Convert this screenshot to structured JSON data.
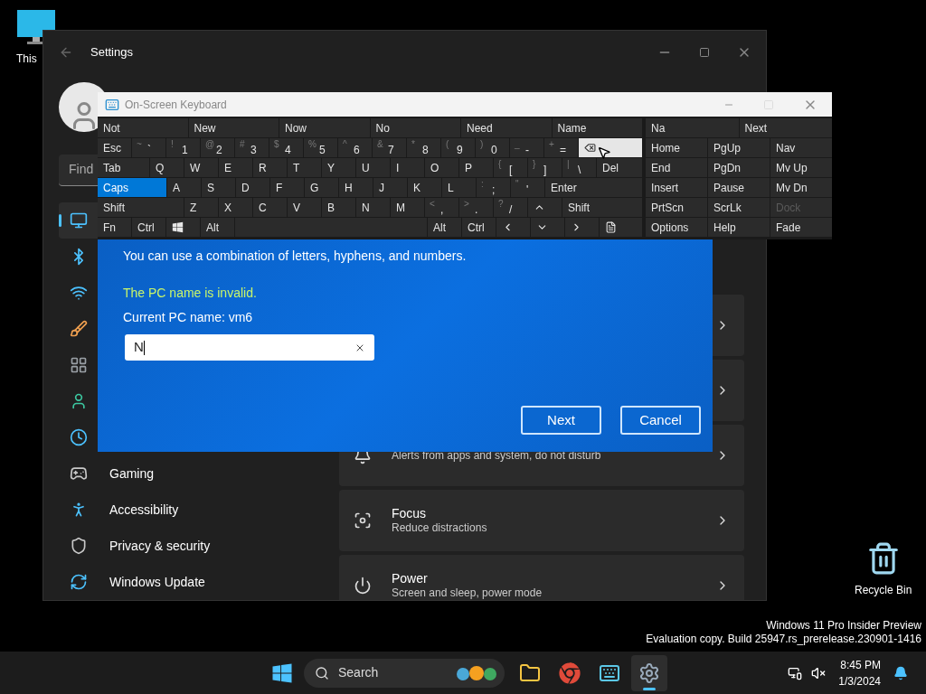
{
  "desktop_icons": [
    {
      "kind": "pc",
      "label": "This"
    },
    {
      "kind": "bin",
      "label": "Recycle Bin"
    }
  ],
  "settings": {
    "title": "Settings",
    "search_placeholder": "Find",
    "sidebar": [
      {
        "selected": true
      },
      {
        "selected": false
      },
      {
        "selected": false
      },
      {
        "selected": false
      },
      {
        "selected": false
      },
      {
        "selected": false
      },
      {
        "selected": false
      },
      {
        "label": "Gaming",
        "selected": false
      },
      {
        "label": "Accessibility",
        "selected": false
      },
      {
        "label": "Privacy & security",
        "selected": false
      },
      {
        "label": "Windows Update",
        "selected": false
      }
    ],
    "cards": [
      {
        "kind": "covered"
      },
      {
        "kind": "covered"
      },
      {
        "kind": "item",
        "subtitle": "Alerts from apps and system, do not disturb"
      },
      {
        "kind": "item",
        "title": "Focus",
        "subtitle": "Reduce distractions"
      },
      {
        "kind": "item",
        "title": "Power",
        "subtitle": "Screen and sleep, power mode"
      }
    ]
  },
  "dialog": {
    "hint": "You can use a combination of letters, hyphens, and numbers.",
    "error": "The PC name is invalid.",
    "current": "Current PC name: vm6",
    "value": "N",
    "buttons": [
      "Next",
      "Cancel"
    ]
  },
  "keyboard": {
    "title": "On-Screen Keyboard",
    "predictions": [
      "Not",
      "New",
      "Now",
      "No",
      "Need",
      "Name"
    ],
    "nav_predictions": [
      "Na",
      "Next"
    ],
    "key_lines": [
      {
        "keys": [
          {
            "label": "Esc",
            "on": false,
            "hovered": false
          },
          {
            "label": "`",
            "shift": "~",
            "on": false,
            "hovered": false
          },
          {
            "label": "1",
            "shift": "!",
            "on": false,
            "hovered": false
          },
          {
            "label": "2",
            "shift": "@",
            "on": false,
            "hovered": false
          },
          {
            "label": "3",
            "shift": "#",
            "on": false,
            "hovered": false
          },
          {
            "label": "4",
            "shift": "$",
            "on": false,
            "hovered": false
          },
          {
            "label": "5",
            "shift": "%",
            "on": false,
            "hovered": false
          },
          {
            "label": "6",
            "shift": "^",
            "on": false,
            "hovered": false
          },
          {
            "label": "7",
            "shift": "&",
            "on": false,
            "hovered": false
          },
          {
            "label": "8",
            "shift": "*",
            "on": false,
            "hovered": false
          },
          {
            "label": "9",
            "shift": "(",
            "on": false,
            "hovered": false
          },
          {
            "label": "0",
            "shift": ")",
            "on": false,
            "hovered": false
          },
          {
            "label": "-",
            "shift": "_",
            "on": false,
            "hovered": false
          },
          {
            "label": "=",
            "shift": "+",
            "on": false,
            "hovered": false
          },
          {
            "kind": "backspace",
            "on": false,
            "hovered": true
          }
        ]
      },
      {
        "keys": [
          {
            "label": "Tab",
            "on": false,
            "hovered": false
          },
          {
            "label": "Q",
            "on": false,
            "hovered": false
          },
          {
            "label": "W",
            "on": false,
            "hovered": false
          },
          {
            "label": "E",
            "on": false,
            "hovered": false
          },
          {
            "label": "R",
            "on": false,
            "hovered": false
          },
          {
            "label": "T",
            "on": false,
            "hovered": false
          },
          {
            "label": "Y",
            "on": false,
            "hovered": false
          },
          {
            "label": "U",
            "on": false,
            "hovered": false
          },
          {
            "label": "I",
            "on": false,
            "hovered": false
          },
          {
            "label": "O",
            "on": false,
            "hovered": false
          },
          {
            "label": "P",
            "on": false,
            "hovered": false
          },
          {
            "label": "[",
            "shift": "{",
            "on": false,
            "hovered": false
          },
          {
            "label": "]",
            "shift": "}",
            "on": false,
            "hovered": false
          },
          {
            "label": "\\",
            "shift": "|",
            "on": false,
            "hovered": false
          },
          {
            "label": "Del",
            "on": false,
            "hovered": false
          }
        ]
      },
      {
        "keys": [
          {
            "label": "Caps",
            "on": true,
            "hovered": false
          },
          {
            "label": "A",
            "on": false,
            "hovered": false
          },
          {
            "label": "S",
            "on": false,
            "hovered": false
          },
          {
            "label": "D",
            "on": false,
            "hovered": false
          },
          {
            "label": "F",
            "on": false,
            "hovered": false
          },
          {
            "label": "G",
            "on": false,
            "hovered": false
          },
          {
            "label": "H",
            "on": false,
            "hovered": false
          },
          {
            "label": "J",
            "on": false,
            "hovered": false
          },
          {
            "label": "K",
            "on": false,
            "hovered": false
          },
          {
            "label": "L",
            "on": false,
            "hovered": false
          },
          {
            "label": ";",
            "shift": ":",
            "on": false,
            "hovered": false
          },
          {
            "label": "'",
            "shift": "\"",
            "on": false,
            "hovered": false
          },
          {
            "label": "Enter",
            "on": false,
            "hovered": false
          }
        ]
      },
      {
        "keys": [
          {
            "label": "Shift",
            "on": false,
            "hovered": false
          },
          {
            "label": "Z",
            "on": false,
            "hovered": false
          },
          {
            "label": "X",
            "on": false,
            "hovered": false
          },
          {
            "label": "C",
            "on": false,
            "hovered": false
          },
          {
            "label": "V",
            "on": false,
            "hovered": false
          },
          {
            "label": "B",
            "on": false,
            "hovered": false
          },
          {
            "label": "N",
            "on": false,
            "hovered": false
          },
          {
            "label": "M",
            "on": false,
            "hovered": false
          },
          {
            "label": ",",
            "shift": "<",
            "on": false,
            "hovered": false
          },
          {
            "label": ".",
            "shift": ">",
            "on": false,
            "hovered": false
          },
          {
            "label": "/",
            "shift": "?",
            "on": false,
            "hovered": false
          },
          {
            "kind": "up",
            "on": false,
            "hovered": false
          },
          {
            "label": "Shift",
            "on": false,
            "hovered": false
          }
        ]
      },
      {
        "keys": [
          {
            "label": "Fn",
            "on": false,
            "hovered": false
          },
          {
            "label": "Ctrl",
            "on": false,
            "hovered": false
          },
          {
            "kind": "windows",
            "on": false,
            "hovered": false
          },
          {
            "label": "Alt",
            "on": false,
            "hovered": false
          },
          {
            "kind": "space",
            "on": false,
            "hovered": false
          },
          {
            "label": "Alt",
            "on": false,
            "hovered": false
          },
          {
            "label": "Ctrl",
            "on": false,
            "hovered": false
          },
          {
            "kind": "left",
            "on": false,
            "hovered": false
          },
          {
            "kind": "down",
            "on": false,
            "hovered": false
          },
          {
            "kind": "right",
            "on": false,
            "hovered": false
          },
          {
            "kind": "menu",
            "on": false,
            "hovered": false
          }
        ]
      }
    ],
    "nav_lines": [
      {
        "keys": [
          {
            "label": "Home",
            "disabled": false
          },
          {
            "label": "PgUp",
            "disabled": false
          },
          {
            "label": "Nav",
            "disabled": false
          }
        ]
      },
      {
        "keys": [
          {
            "label": "End",
            "disabled": false
          },
          {
            "label": "PgDn",
            "disabled": false
          },
          {
            "label": "Mv Up",
            "disabled": false
          }
        ]
      },
      {
        "keys": [
          {
            "label": "Insert",
            "disabled": false
          },
          {
            "label": "Pause",
            "disabled": false
          },
          {
            "label": "Mv Dn",
            "disabled": false
          }
        ]
      },
      {
        "keys": [
          {
            "label": "PrtScn",
            "disabled": false
          },
          {
            "label": "ScrLk",
            "disabled": false
          },
          {
            "label": "Dock",
            "disabled": true
          }
        ]
      },
      {
        "keys": [
          {
            "label": "Options",
            "disabled": false
          },
          {
            "label": "Help",
            "disabled": false
          },
          {
            "label": "Fade",
            "disabled": false
          }
        ]
      }
    ]
  },
  "build_info": [
    "Windows 11 Pro Insider Preview",
    "Evaluation copy. Build 25947.rs_prerelease.230901-1416"
  ],
  "taskbar": {
    "search": "Search",
    "apps": [
      {
        "active": false
      },
      {
        "active": false
      },
      {
        "active": false
      },
      {
        "active": true
      }
    ],
    "time": "8:45 PM",
    "date": "1/3/2024"
  }
}
